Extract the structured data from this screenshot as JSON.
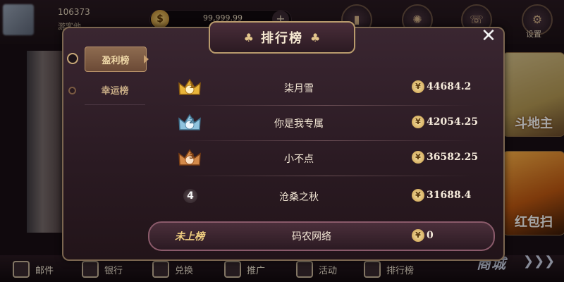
{
  "background": {
    "user_id": "106373",
    "user_name": "游客他",
    "coins": "99,999.99",
    "settings_label": "设置",
    "game_cards": [
      "斗地主",
      "红包扫"
    ],
    "bottom_nav": [
      "邮件",
      "银行",
      "兑换",
      "推广",
      "活动",
      "排行榜"
    ],
    "shop_label": "商城",
    "shop_arrows": "❯❯❯"
  },
  "modal": {
    "title": "排行榜",
    "title_decor": "♣",
    "close": "✕",
    "tabs": [
      {
        "label": "盈利榜",
        "active": true
      },
      {
        "label": "幸运榜",
        "active": false
      }
    ],
    "currency_symbol": "¥",
    "ranks": [
      {
        "rank": "1",
        "badge": "gold-crown-icon",
        "color": "#e9b53a",
        "name": "柒月雪",
        "amount": "44684.2"
      },
      {
        "rank": "2",
        "badge": "silver-crown-icon",
        "color": "#8fc3de",
        "name": "你是我专属",
        "amount": "42054.25"
      },
      {
        "rank": "3",
        "badge": "bronze-crown-icon",
        "color": "#d48a4a",
        "name": "小不点",
        "amount": "36582.25"
      },
      {
        "rank": "4",
        "badge": "rank-4-badge",
        "color": "#5a4a50",
        "name": "沧桑之秋",
        "amount": "31688.4"
      }
    ],
    "my_rank": {
      "status": "未上榜",
      "name": "码农网络",
      "amount": "0"
    }
  }
}
